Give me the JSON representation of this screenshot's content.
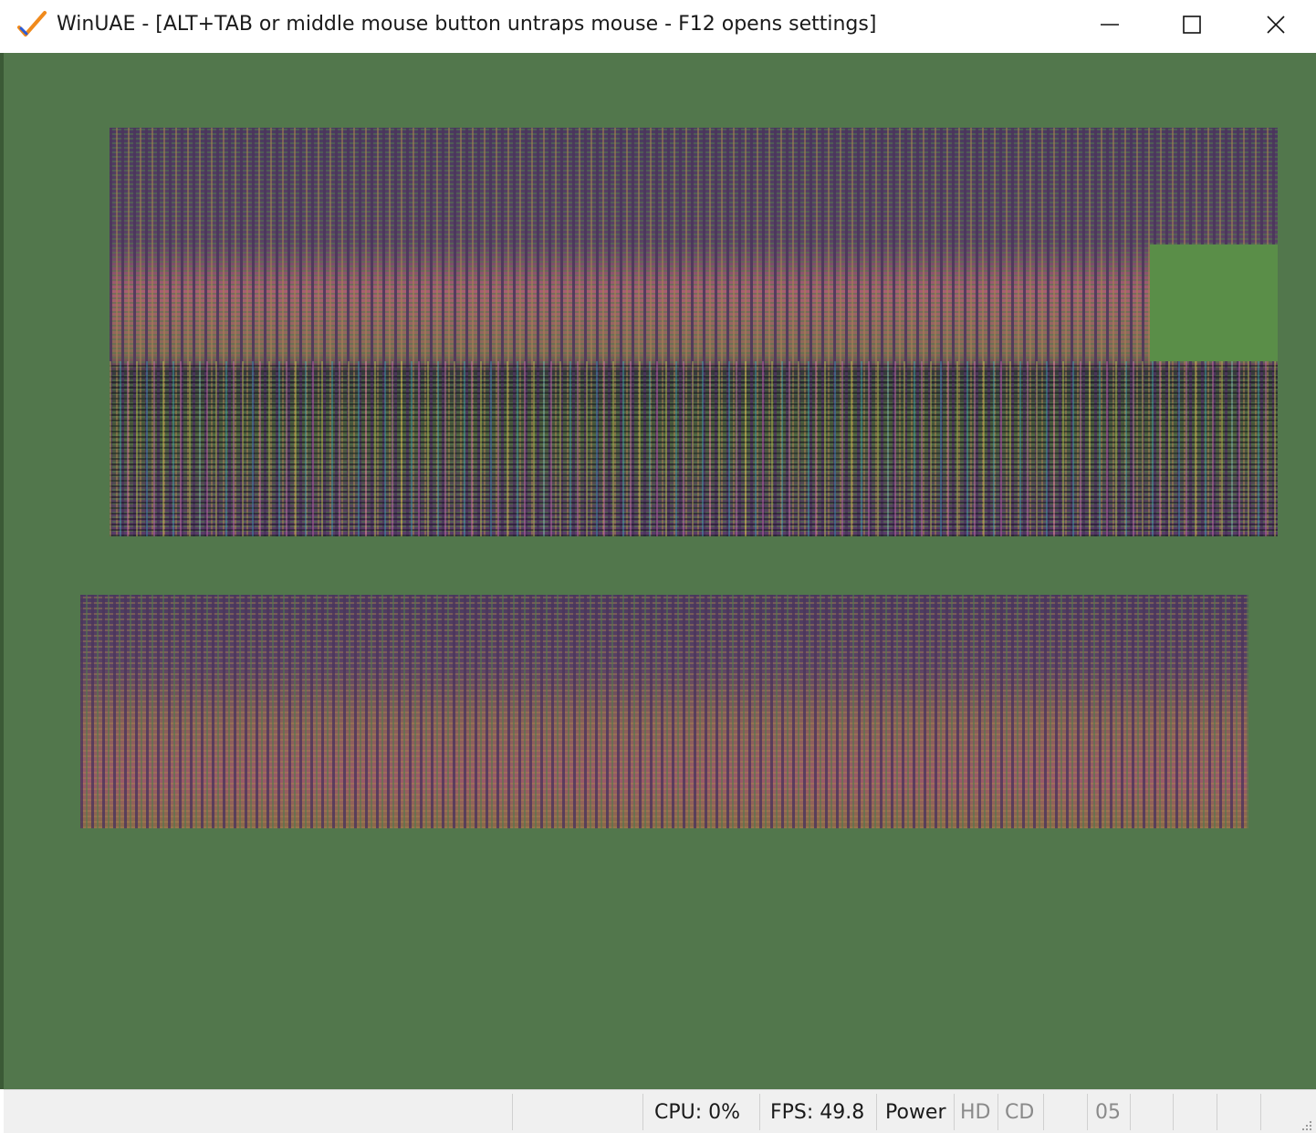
{
  "window": {
    "title": "WinUAE - [ALT+TAB or middle mouse button untraps mouse - F12 opens settings]",
    "app_icon": "winuae-checkmark-icon",
    "controls": {
      "minimize": "minimize-icon",
      "maximize": "maximize-icon",
      "close": "close-icon"
    }
  },
  "display": {
    "background_color": "#52774c"
  },
  "statusbar": {
    "cpu": "CPU: 0%",
    "fps": "FPS: 49.8",
    "power": "Power",
    "hd": "HD",
    "cd": "CD",
    "drive": "05"
  }
}
